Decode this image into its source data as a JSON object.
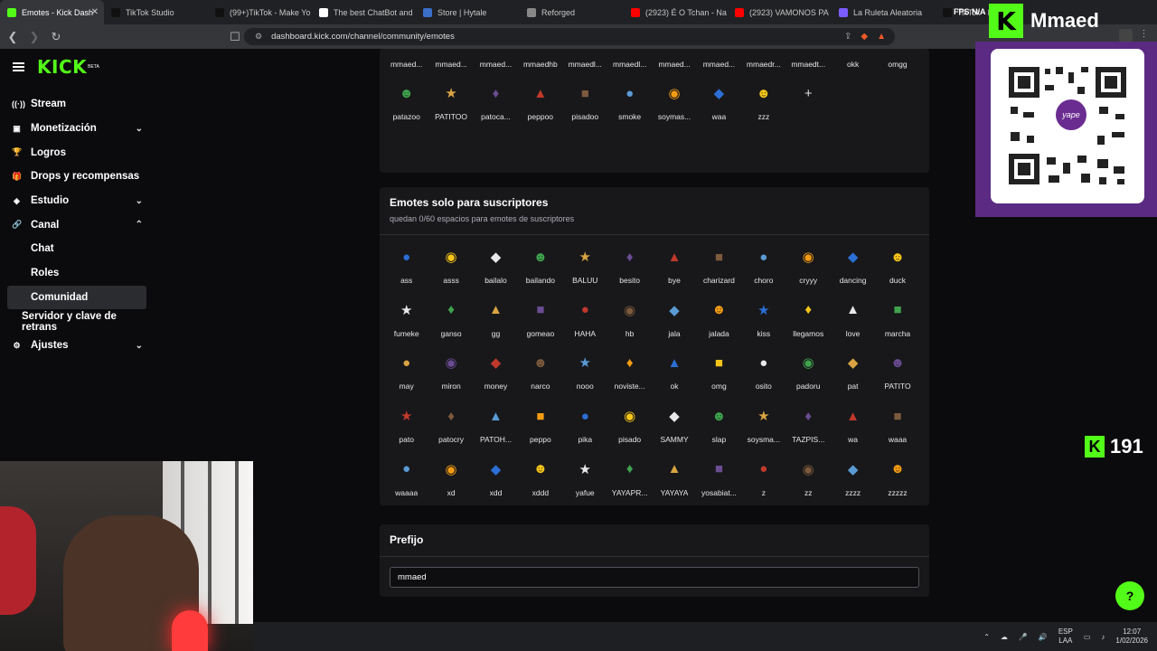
{
  "browser": {
    "tabs": [
      {
        "title": "Emotes - Kick Dash",
        "color": "#53fc18",
        "active": true
      },
      {
        "title": "TikTok Studio",
        "color": "#111111"
      },
      {
        "title": "(99+)TikTok - Make Yo",
        "color": "#111111"
      },
      {
        "title": "The best ChatBot and",
        "color": "#ffffff"
      },
      {
        "title": "Store | Hytale",
        "color": "#3b6ec9"
      },
      {
        "title": "Reforged",
        "color": "#888888"
      },
      {
        "title": "(2923) É O Tchan - Na",
        "color": "#ff0000"
      },
      {
        "title": "(2923) VAMONOS PA",
        "color": "#ff0000"
      },
      {
        "title": "La Ruleta Aleatoria",
        "color": "#7b5cff"
      },
      {
        "title": "TikTok - Ma",
        "color": "#111111"
      }
    ],
    "close_glyph": "✕",
    "url": "dashboard.kick.com/channel/community/emotes",
    "overlay_text": "FPS N/A"
  },
  "sidebar": {
    "logo": "KICK",
    "beta": "BETA",
    "items": [
      {
        "label": "Stream",
        "icon": "radio-icon",
        "glyph": "((·))",
        "chevron": ""
      },
      {
        "label": "Monetización",
        "icon": "wallet-icon",
        "glyph": "▣",
        "chevron": "⌄"
      },
      {
        "label": "Logros",
        "icon": "trophy-icon",
        "glyph": "🏆",
        "chevron": ""
      },
      {
        "label": "Drops y recompensas",
        "icon": "gift-icon",
        "glyph": "🎁",
        "chevron": ""
      },
      {
        "label": "Estudio",
        "icon": "studio-icon",
        "glyph": "◈",
        "chevron": "⌄"
      },
      {
        "label": "Canal",
        "icon": "link-icon",
        "glyph": "🔗",
        "chevron": "⌃"
      }
    ],
    "sub_items": [
      {
        "label": "Chat",
        "active": false
      },
      {
        "label": "Roles",
        "active": false
      },
      {
        "label": "Comunidad",
        "active": true
      },
      {
        "label": "Servidor y clave de retrans",
        "active": false
      }
    ],
    "settings": {
      "label": "Ajustes",
      "icon": "gear-icon",
      "glyph": "⚙",
      "chevron": "⌄"
    }
  },
  "channel_emotes": {
    "row1": [
      "mmaed...",
      "mmaed...",
      "mmaed...",
      "mmaedhb",
      "mmaedl...",
      "mmaedl...",
      "mmaed...",
      "mmaed...",
      "mmaedr...",
      "mmaedt...",
      "okk",
      "omgg"
    ],
    "row2": [
      "patazoo",
      "PATITOO",
      "patoca...",
      "peppoo",
      "pisadoo",
      "smoke",
      "soymas...",
      "waa",
      "zzz"
    ],
    "add_glyph": "+"
  },
  "sub_emotes": {
    "title": "Emotes solo para suscriptores",
    "subtitle": "quedan 0/60 espacios para emotes de suscriptores",
    "items": [
      "ass",
      "asss",
      "bailalo",
      "bailando",
      "BALUU",
      "besito",
      "bye",
      "charizard",
      "choro",
      "cryyy",
      "dancing",
      "duck",
      "fumeke",
      "ganso",
      "gg",
      "gomeao",
      "HAHA",
      "hb",
      "jala",
      "jalada",
      "kiss",
      "llegamos",
      "love",
      "marcha",
      "may",
      "miron",
      "money",
      "narco",
      "nooo",
      "noviste...",
      "ok",
      "omg",
      "osito",
      "padoru",
      "pat",
      "PATITO",
      "pato",
      "patocry",
      "PATOH...",
      "peppo",
      "pika",
      "pisado",
      "SAMMY",
      "slap",
      "soysma...",
      "TAZPIS...",
      "wa",
      "waaa",
      "waaaa",
      "xd",
      "xdd",
      "xddd",
      "yafue",
      "YAYAPR...",
      "YAYAYA",
      "yosabiat...",
      "z",
      "zz",
      "zzzz",
      "zzzzz"
    ]
  },
  "prefix": {
    "title": "Prefijo",
    "value": "mmaed"
  },
  "overlay": {
    "brand_letter": "K",
    "name": "Mmaed",
    "yape": "yape",
    "count": "191"
  },
  "taskbar": {
    "lang1": "ESP",
    "lang2": "LAA",
    "time": "12:07",
    "date": "1/02/2026"
  }
}
